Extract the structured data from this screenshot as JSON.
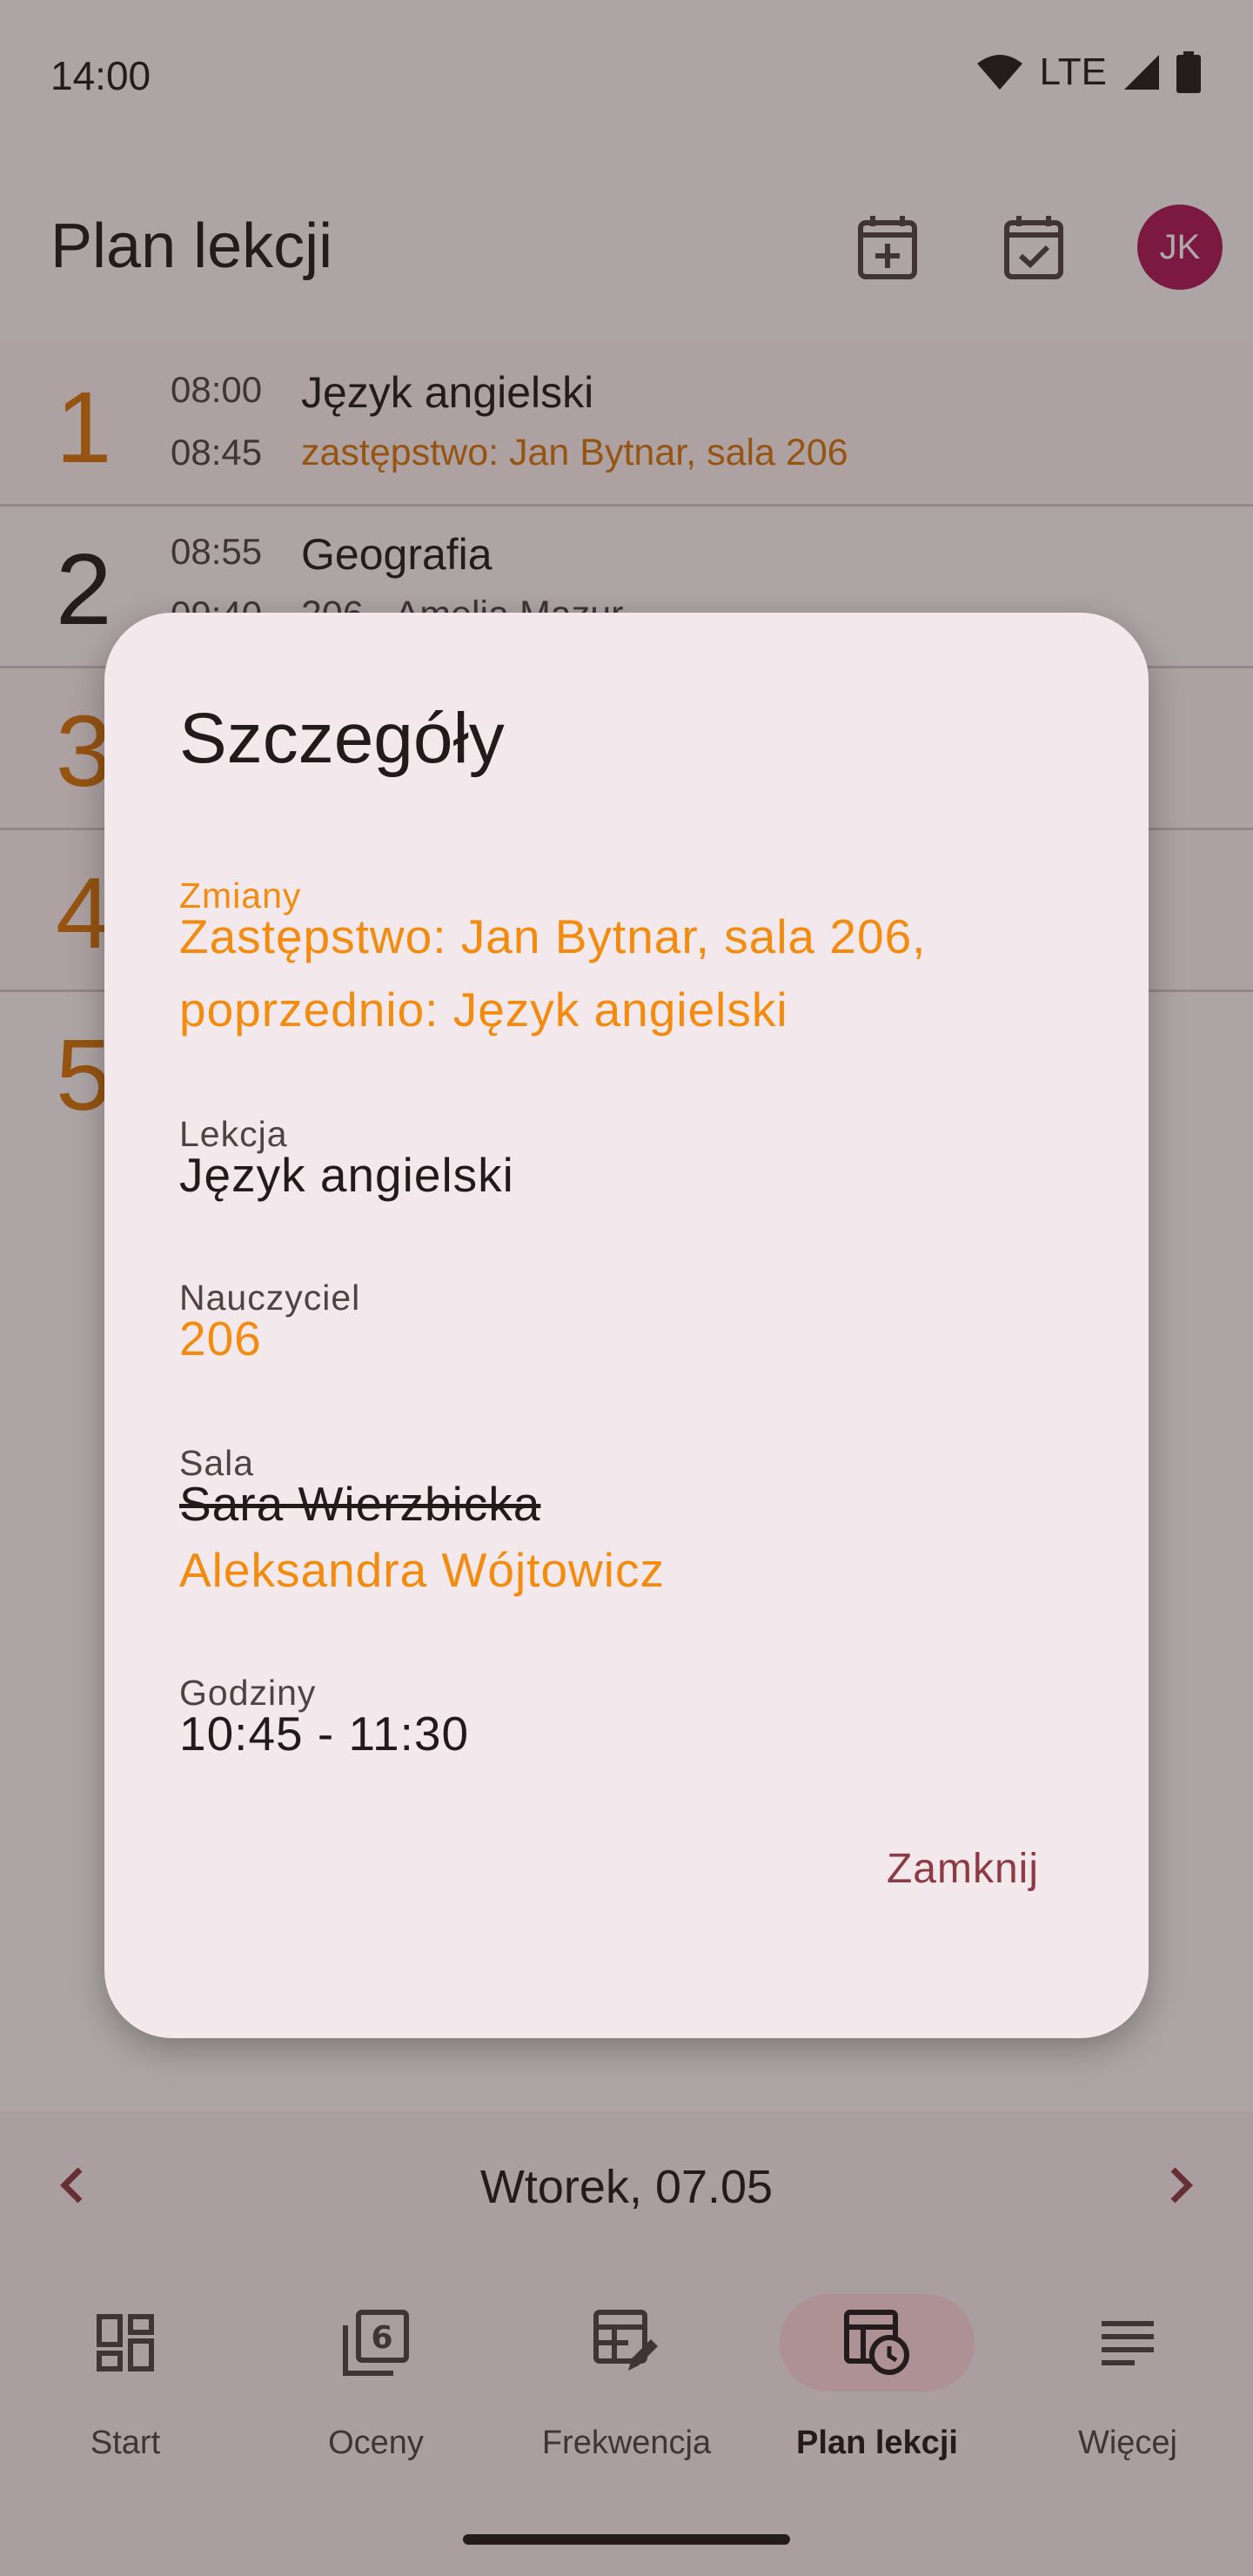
{
  "status_bar": {
    "time": "14:00",
    "network": "LTE"
  },
  "app_bar": {
    "title": "Plan lekcji",
    "avatar_initials": "JK"
  },
  "lessons": [
    {
      "number": "1",
      "start": "08:00",
      "end": "08:45",
      "subject": "Język angielski",
      "info": "zastępstwo: Jan Bytnar, sala 206",
      "changed": true
    },
    {
      "number": "2",
      "start": "08:55",
      "end": "09:40",
      "subject": "Geografia",
      "info": "206 - Amelia Mazur",
      "changed": false
    },
    {
      "number": "3",
      "start": "",
      "end": "",
      "subject": "",
      "info": "",
      "changed": true
    },
    {
      "number": "4",
      "start": "",
      "end": "",
      "subject": "",
      "info": "",
      "changed": true
    },
    {
      "number": "5",
      "start": "",
      "end": "",
      "subject": "",
      "info": "",
      "changed": true
    }
  ],
  "date_bar": {
    "label": "Wtorek, 07.05"
  },
  "bottom_nav": [
    {
      "label": "Start",
      "icon": "dashboard-icon"
    },
    {
      "label": "Oceny",
      "icon": "grades-icon"
    },
    {
      "label": "Frekwencja",
      "icon": "attendance-icon"
    },
    {
      "label": "Plan lekcji",
      "icon": "timetable-icon",
      "active": true
    },
    {
      "label": "Więcej",
      "icon": "more-icon"
    }
  ],
  "dialog": {
    "title": "Szczegóły",
    "changes": {
      "label": "Zmiany",
      "line1": "Zastępstwo: Jan Bytnar, sala 206,",
      "line2": "poprzednio: Język angielski"
    },
    "lesson": {
      "label": "Lekcja",
      "value": "Język angielski"
    },
    "teacher": {
      "label": "Nauczyciel",
      "value": "206"
    },
    "room": {
      "label": "Sala",
      "old_value": "Sara Wierzbicka",
      "new_value": "Aleksandra Wójtowicz"
    },
    "hours": {
      "label": "Godziny",
      "value": "10:45 - 11:30"
    },
    "close_label": "Zamknij"
  },
  "colors": {
    "changed": "#f28b0e",
    "accent": "#b01856",
    "close": "#8c3b44"
  }
}
